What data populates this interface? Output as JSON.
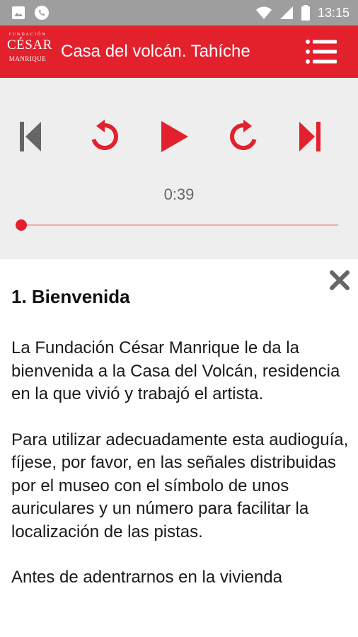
{
  "status_bar": {
    "time": "13:15",
    "icons": [
      "image-icon",
      "whatsapp-icon",
      "wifi-icon",
      "signal-icon",
      "battery-icon"
    ]
  },
  "app_bar": {
    "logo": {
      "line1": "FUNDACIÓN",
      "line2": "CÉSAR",
      "line3": "MANRIQUE"
    },
    "title": "Casa del volcán. Tahíche",
    "menu_icon": "hamburger-icon"
  },
  "player": {
    "controls": [
      "skip-previous-icon",
      "rewind-icon",
      "play-icon",
      "forward-icon",
      "skip-next-icon"
    ],
    "time": "0:39",
    "progress": 0.0
  },
  "content": {
    "close_icon": "close-icon",
    "title": "1. Bienvenida",
    "paragraphs": [
      "La Fundación César Manrique le da la bienvenida a la Casa del Volcán, residencia en la que vivió y trabajó el artista.",
      "Para utilizar adecuadamente esta audioguía, fíjese, por favor, en las señales distribuidas por el museo con el símbolo de unos auriculares y un número para facilitar la localización de las pistas.",
      "Antes de adentrarnos en la vivienda"
    ]
  },
  "colors": {
    "accent": "#e3212d",
    "status_bar": "#9e9e9e",
    "player_bg": "#eeeeee",
    "progress_track": "#f2a9ad"
  }
}
